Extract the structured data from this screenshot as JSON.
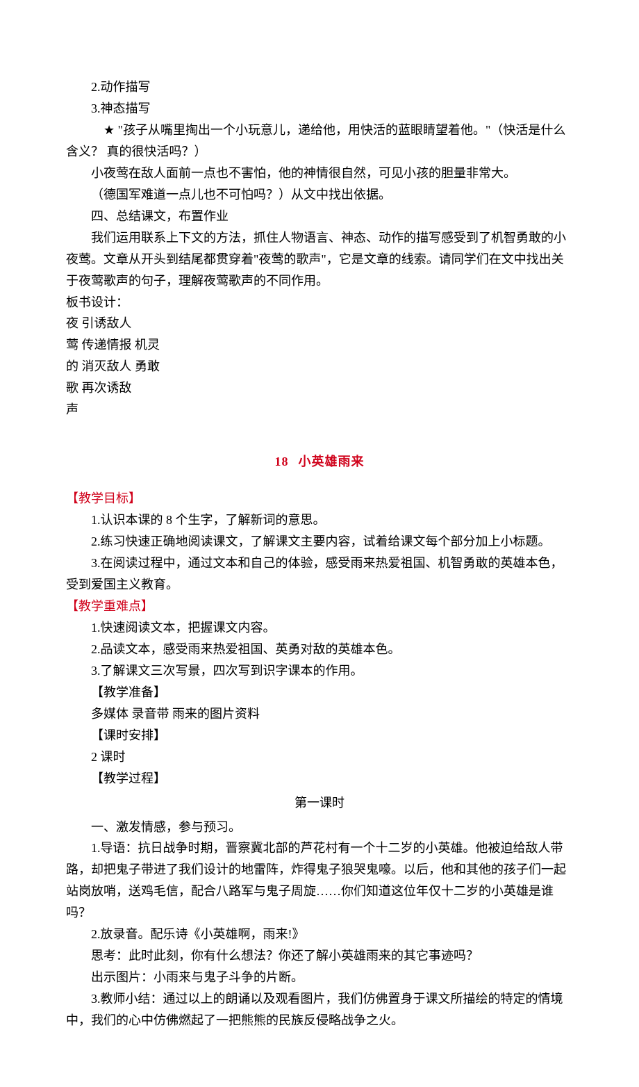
{
  "topBlock": {
    "line1": "2.动作描写",
    "line2": "3.神态描写",
    "line3_star": "★",
    "line3_text": " \"孩子从嘴里掏出一个小玩意儿，递给他，用快活的蓝眼睛望着他。\"（快活是什么含义？ 真的很快活吗？）",
    "line4": "小夜莺在敌人面前一点也不害怕，他的神情很自然，可见小孩的胆量非常大。",
    "line5": "（德国军难道一点儿也不可怕吗？）从文中找出依据。",
    "line6": "四、总结课文，布置作业",
    "line7": "我们运用联系上下文的方法，抓住人物语言、神态、动作的描写感受到了机智勇敢的小夜莺。文章从开头到结尾都贯穿着\"夜莺的歌声\"，它是文章的线索。请同学们在文中找出关于夜莺歌声的句子，理解夜莺歌声的不同作用。",
    "boardTitle": "板书设计：",
    "board1": "夜  引诱敌人",
    "board2": "莺  传递情报  机灵",
    "board3": "的  消灭敌人  勇敢",
    "board4": "歌  再次诱敌",
    "board5": "声"
  },
  "lessonTitle": {
    "num": "18",
    "name": "小英雄雨来"
  },
  "objectives": {
    "header": "【教学目标】",
    "item1": "1.认识本课的 8 个生字，了解新词的意思。",
    "item2": "2.练习快速正确地阅读课文，了解课文主要内容，试着给课文每个部分加上小标题。",
    "item3": "3.在阅读过程中，通过文本和自己的体验，感受雨来热爱祖国、机智勇敢的英雄本色，受到爱国主义教育。"
  },
  "difficulties": {
    "header": "【教学重难点】",
    "item1": "1.快速阅读文本，把握课文内容。",
    "item2": "2.品读文本，感受雨来热爱祖国、英勇对敌的英雄本色。",
    "item3": "3.了解课文三次写景，四次写到识字课本的作用。"
  },
  "prep": {
    "header": "【教学准备】",
    "text": "多媒体  录音带  雨来的图片资料"
  },
  "schedule": {
    "header": "【课时安排】",
    "text": "2 课时"
  },
  "process": {
    "header": "【教学过程】"
  },
  "period1": {
    "title": "第一课时",
    "sec1": "一、激发情感，参与预习。",
    "p1": "1.导语：抗日战争时期，晋察冀北部的芦花村有一个十二岁的小英雄。他被迫给敌人带路，却把鬼子带进了我们设计的地雷阵，炸得鬼子狼哭鬼嚎。以后，他和其他的孩子们一起站岗放哨，送鸡毛信，配合八路军与鬼子周旋……你们知道这位年仅十二岁的小英雄是谁吗？",
    "p2": "2.放录音。配乐诗《小英雄啊，雨来!》",
    "p3": "思考：此时此刻，你有什么想法？你还了解小英雄雨来的其它事迹吗？",
    "p4": "出示图片：小雨来与鬼子斗争的片断。",
    "p5": "3.教师小结：通过以上的朗诵以及观看图片，我们仿佛置身于课文所描绘的特定的情境中，我们的心中仿佛燃起了一把熊熊的民族反侵略战争之火。"
  }
}
